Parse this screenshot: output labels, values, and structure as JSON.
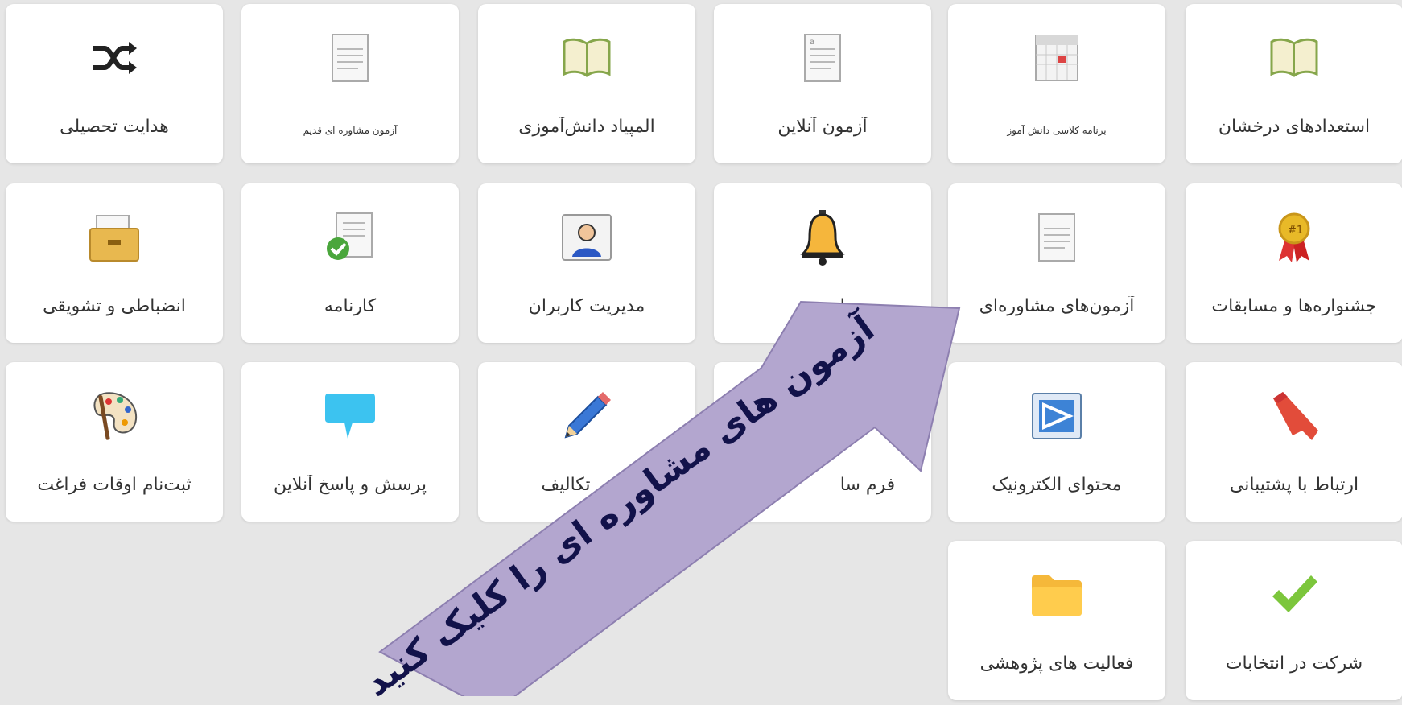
{
  "tiles": [
    {
      "label": "استعدادهای درخشان",
      "icon": "book-icon",
      "small": false
    },
    {
      "label": "برنامه کلاسی دانش آموز",
      "icon": "calendar-icon",
      "small": true
    },
    {
      "label": "آزمون آنلاین",
      "icon": "document-icon",
      "small": false
    },
    {
      "label": "المپیاد دانش‌آموزی",
      "icon": "book-icon",
      "small": false
    },
    {
      "label": "آزمون مشاوره ای قدیم",
      "icon": "document-icon",
      "small": true
    },
    {
      "label": "هدایت تحصیلی",
      "icon": "shuffle-icon",
      "small": false
    },
    {
      "label": "جشنواره‌ها و مسابقات",
      "icon": "award-ribbon-icon",
      "small": false
    },
    {
      "label": "آزمون‌های مشاوره‌ای",
      "icon": "document-icon",
      "small": false
    },
    {
      "label": "ماد",
      "icon": "bell-icon",
      "small": false
    },
    {
      "label": "مدیریت کاربران",
      "icon": "user-card-icon",
      "small": false
    },
    {
      "label": "کارنامه",
      "icon": "report-check-icon",
      "small": false
    },
    {
      "label": "انضباطی و تشویقی",
      "icon": "drawer-icon",
      "small": false
    },
    {
      "label": "ارتباط با پشتیبانی",
      "icon": "bookmark-icon",
      "small": false
    },
    {
      "label": "محتوای الکترونیک",
      "icon": "screen-icon",
      "small": false
    },
    {
      "label": "فرم سا",
      "icon": "blank-icon",
      "small": false
    },
    {
      "label": "تکالیف",
      "icon": "pencil-icon",
      "small": false
    },
    {
      "label": "پرسش و پاسخ آنلاین",
      "icon": "chat-bubble-icon",
      "small": false
    },
    {
      "label": "ثبت‌نام اوقات فراغت",
      "icon": "palette-icon",
      "small": false
    },
    {
      "label": "شرکت در انتخابات",
      "icon": "checkmark-icon",
      "small": false
    },
    {
      "label": "فعالیت های پژوهشی",
      "icon": "folder-icon",
      "small": false
    }
  ],
  "callout": {
    "text": "آزمون های مشاوره ای را کلیک کنید",
    "color": "#b3a6cf"
  }
}
